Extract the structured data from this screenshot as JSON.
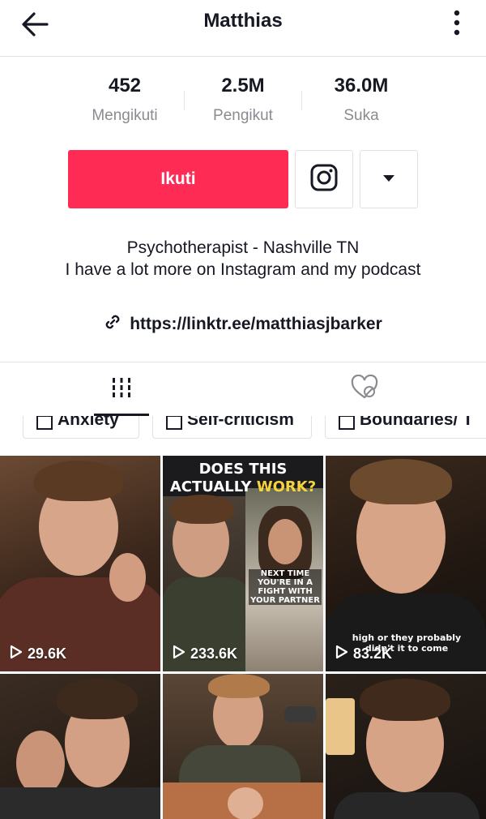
{
  "header": {
    "title": "Matthias",
    "back_icon": "back-arrow-icon",
    "more_icon": "more-vertical-icon"
  },
  "stats": [
    {
      "value": "452",
      "label": "Mengikuti"
    },
    {
      "value": "2.5M",
      "label": "Pengikut"
    },
    {
      "value": "36.0M",
      "label": "Suka"
    }
  ],
  "actions": {
    "follow_label": "Ikuti",
    "instagram_icon": "instagram-icon",
    "dropdown_icon": "caret-down-icon",
    "accent_color": "#fe2c55"
  },
  "bio": {
    "line1": "Psychotherapist - Nashville TN",
    "line2": "I have a lot more on Instagram and my podcast",
    "link": "https://linktr.ee/matthiasjbarker",
    "link_icon": "link-icon"
  },
  "tabs": [
    {
      "icon": "video-grid-icon",
      "active": true
    },
    {
      "icon": "liked-hidden-icon",
      "active": false
    }
  ],
  "playlists": [
    {
      "label": "Anxiety"
    },
    {
      "label": "Self-criticism"
    },
    {
      "label": "Boundaries/ T"
    }
  ],
  "videos": [
    {
      "views": "29.6K"
    },
    {
      "views": "233.6K",
      "overlay_line1": "DOES THIS",
      "overlay_line2a": "ACTUALLY",
      "overlay_line2b": "WORK?",
      "caption": "NEXT TIME YOU'RE IN A FIGHT WITH YOUR PARTNER"
    },
    {
      "views": "83.2K",
      "caption": "high or they probably didn't it to come"
    },
    {
      "views": ""
    },
    {
      "views": ""
    },
    {
      "views": ""
    }
  ]
}
